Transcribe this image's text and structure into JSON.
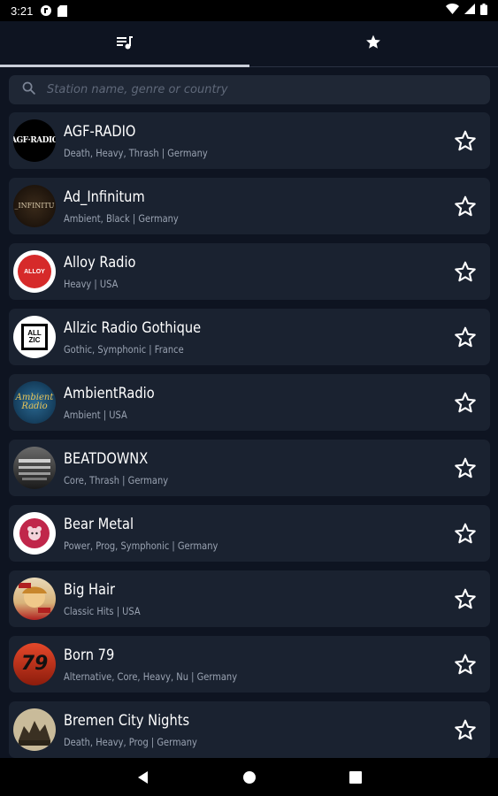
{
  "status_bar": {
    "time": "3:21",
    "icons": [
      "app-notification-icon",
      "sd-card-icon",
      "wifi-icon",
      "cellular-signal-icon",
      "battery-icon"
    ]
  },
  "tabs": [
    {
      "icon": "playlist-music-icon",
      "active": true
    },
    {
      "icon": "star-filled-icon",
      "active": false
    }
  ],
  "search": {
    "placeholder": "Station name, genre or country",
    "value": ""
  },
  "stations": [
    {
      "name": "AGF-RADIO",
      "meta": "Death, Heavy, Thrash | Germany",
      "logo_text": "AGF·RADIO",
      "logo_bg": "#000000",
      "logo_fg": "#ffffff"
    },
    {
      "name": "Ad_Infinitum",
      "meta": "Ambient, Black | Germany",
      "logo_text": "_INFINITU",
      "logo_bg": "#1b130c",
      "logo_fg": "#d6c7a8"
    },
    {
      "name": "Alloy Radio",
      "meta": "Heavy | USA",
      "logo_text": "ALLOY",
      "logo_bg": "#d62a2a",
      "logo_fg": "#ffffff"
    },
    {
      "name": "Allzic Radio Gothique",
      "meta": "Gothic, Symphonic | France",
      "logo_text": "ALL ZIC",
      "logo_bg": "#ffffff",
      "logo_fg": "#000000"
    },
    {
      "name": "AmbientRadio",
      "meta": "Ambient | USA",
      "logo_text": "Ambient Radio",
      "logo_bg": "#0d3a5c",
      "logo_fg": "#e8c458"
    },
    {
      "name": "BEATDOWNX",
      "meta": "Core, Thrash | Germany",
      "logo_text": "",
      "logo_bg": "#3a3a3a",
      "logo_fg": "#dddddd"
    },
    {
      "name": "Bear Metal",
      "meta": "Power, Prog, Symphonic | Germany",
      "logo_text": "",
      "logo_bg": "#ffffff",
      "logo_fg": "#c0264a"
    },
    {
      "name": "Big Hair",
      "meta": "Classic Hits | USA",
      "logo_text": "",
      "logo_bg": "#e9d9b8",
      "logo_fg": "#b02020"
    },
    {
      "name": "Born 79",
      "meta": "Alternative, Core, Heavy, Nu | Germany",
      "logo_text": "79",
      "logo_bg": "#d53a1a",
      "logo_fg": "#111111"
    },
    {
      "name": "Bremen City Nights",
      "meta": "Death, Heavy, Prog | Germany",
      "logo_text": "",
      "logo_bg": "#8d7f62",
      "logo_fg": "#2b2418"
    }
  ],
  "navbar": {
    "icons": [
      "back-icon",
      "home-icon",
      "recents-icon"
    ]
  },
  "colors": {
    "background": "#0e1421",
    "card": "#1a2230",
    "search_bg": "#1f2735",
    "tab_indicator": "#c9ced8",
    "secondary_text": "#9aa3b2"
  }
}
